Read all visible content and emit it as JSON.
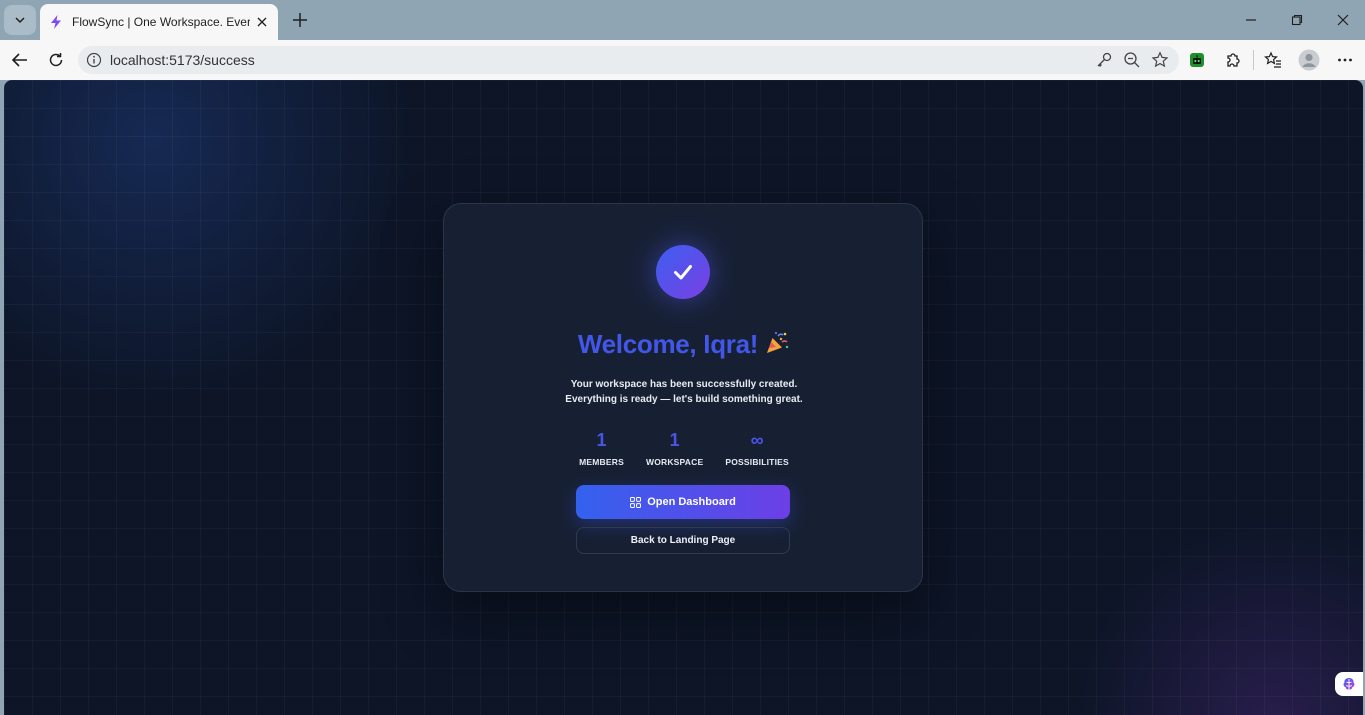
{
  "browser": {
    "tab_title": "FlowSync | One Workspace. Every",
    "url": "localhost:5173/success"
  },
  "page": {
    "heading": "Welcome, Iqra!",
    "subtitle": "Your workspace has been successfully created. Everything is ready — let's build something great.",
    "stats": [
      {
        "value": "1",
        "label": "MEMBERS"
      },
      {
        "value": "1",
        "label": "WORKSPACE"
      },
      {
        "value": "∞",
        "label": "POSSIBILITIES"
      }
    ],
    "primary_button": "Open Dashboard",
    "secondary_button": "Back to Landing Page"
  },
  "colors": {
    "accent_start": "#3461ee",
    "accent_end": "#6c3fe6",
    "heading": "#4257e8",
    "page_bg": "#0d1527",
    "card_bg": "#172033"
  }
}
